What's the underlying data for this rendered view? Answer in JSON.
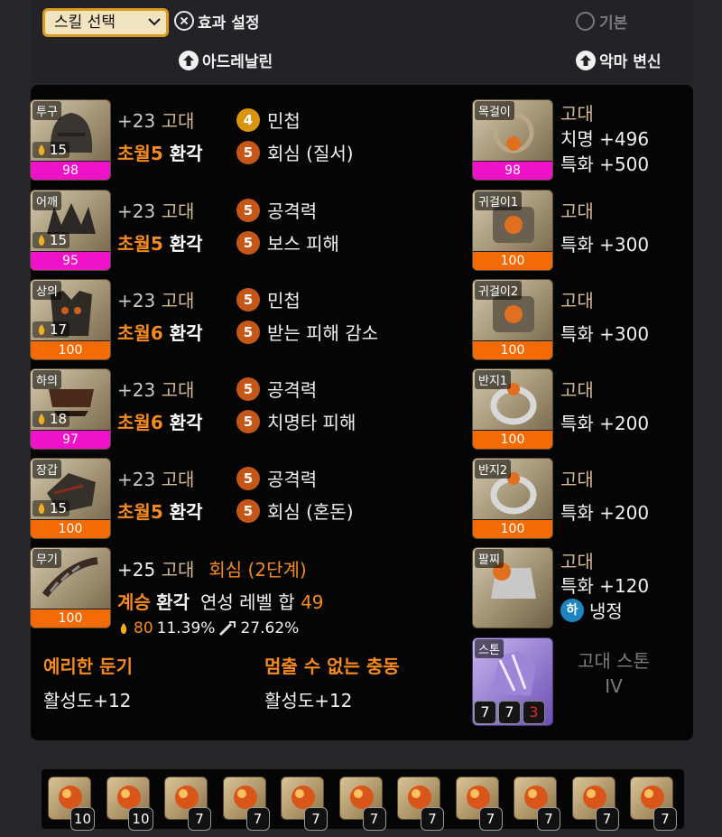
{
  "header": {
    "skill_select": "스킬 선택",
    "effect_setting": "효과 설정",
    "basic": "기본",
    "skill_adrenaline": "아드레날린",
    "skill_demon": "악마 변신"
  },
  "armor": [
    {
      "slot": "투구",
      "level": "15",
      "quality": "98",
      "quality_value": 98,
      "bar": "pink",
      "refine": "+23",
      "grade": "고대",
      "trans_label": "초월",
      "trans_level": "5",
      "elixir_label": "환각",
      "effects": [
        {
          "lv": "4",
          "name": "민첩"
        },
        {
          "lv": "5",
          "name": "회심 (질서)"
        }
      ]
    },
    {
      "slot": "어깨",
      "level": "15",
      "quality": "95",
      "quality_value": 95,
      "bar": "pink",
      "refine": "+23",
      "grade": "고대",
      "trans_label": "초월",
      "trans_level": "5",
      "elixir_label": "환각",
      "effects": [
        {
          "lv": "5",
          "name": "공격력"
        },
        {
          "lv": "5",
          "name": "보스 피해"
        }
      ]
    },
    {
      "slot": "상의",
      "level": "17",
      "quality": "100",
      "quality_value": 100,
      "bar": "orange",
      "refine": "+23",
      "grade": "고대",
      "trans_label": "초월",
      "trans_level": "6",
      "elixir_label": "환각",
      "effects": [
        {
          "lv": "5",
          "name": "민첩"
        },
        {
          "lv": "5",
          "name": "받는 피해 감소"
        }
      ]
    },
    {
      "slot": "하의",
      "level": "18",
      "quality": "97",
      "quality_value": 97,
      "bar": "pink",
      "refine": "+23",
      "grade": "고대",
      "trans_label": "초월",
      "trans_level": "6",
      "elixir_label": "환각",
      "effects": [
        {
          "lv": "5",
          "name": "공격력"
        },
        {
          "lv": "5",
          "name": "치명타 피해"
        }
      ]
    },
    {
      "slot": "장갑",
      "level": "15",
      "quality": "100",
      "quality_value": 100,
      "bar": "orange",
      "refine": "+23",
      "grade": "고대",
      "trans_label": "초월",
      "trans_level": "5",
      "elixir_label": "환각",
      "effects": [
        {
          "lv": "5",
          "name": "공격력"
        },
        {
          "lv": "5",
          "name": "회심 (혼돈)"
        }
      ]
    }
  ],
  "weapon": {
    "slot": "무기",
    "quality": "100",
    "quality_value": 100,
    "refine": "+25",
    "grade": "고대",
    "special_effect": "회심 (2단계)",
    "succession": "계승",
    "elixir_label": "환각",
    "elixir_level_label": "연성 레벨 합",
    "elixir_level_sum": "49",
    "trans_total": "80",
    "stat1": "11.39%",
    "stat2": "27.62%"
  },
  "accessories": [
    {
      "slot": "목걸이",
      "grade": "고대",
      "quality": "98",
      "quality_value": 98,
      "bar": "pink",
      "stats": [
        "치명 +496",
        "특화 +500"
      ]
    },
    {
      "slot": "귀걸이1",
      "grade": "고대",
      "quality": "100",
      "quality_value": 100,
      "bar": "orange",
      "stats": [
        "특화 +300"
      ]
    },
    {
      "slot": "귀걸이2",
      "grade": "고대",
      "quality": "100",
      "quality_value": 100,
      "bar": "orange",
      "stats": [
        "특화 +300"
      ]
    },
    {
      "slot": "반지1",
      "grade": "고대",
      "quality": "100",
      "quality_value": 100,
      "bar": "orange",
      "stats": [
        "특화 +200"
      ]
    },
    {
      "slot": "반지2",
      "grade": "고대",
      "quality": "100",
      "quality_value": 100,
      "bar": "orange",
      "stats": [
        "특화 +200"
      ]
    }
  ],
  "bracelet": {
    "slot": "팔찌",
    "grade": "고대",
    "quality": "100",
    "quality_value": 100,
    "stat": "특화 +120",
    "effect_tier": "하",
    "effect_name": "냉정"
  },
  "engravings": [
    {
      "name": "예리한 둔기",
      "value": "활성도+12"
    },
    {
      "name": "멈출 수 없는 충동",
      "value": "활성도+12"
    }
  ],
  "stone": {
    "slot": "스톤",
    "name_line1": "고대 스톤",
    "name_line2": "IV",
    "values": [
      "7",
      "7",
      "3"
    ]
  },
  "gems": [
    "10",
    "10",
    "7",
    "7",
    "7",
    "7",
    "7",
    "7",
    "7",
    "7",
    "7"
  ],
  "colors": {
    "quality_pink": "#ee12c8",
    "quality_orange": "#f26b06",
    "transcend_orange": "#f58a1f",
    "grade_ancient": "#d4b994",
    "badge_lv4": "#d8960e",
    "badge_lv5": "#c45718",
    "stone_red": "#e02a2a",
    "tier_blue": "#1d86c2"
  }
}
